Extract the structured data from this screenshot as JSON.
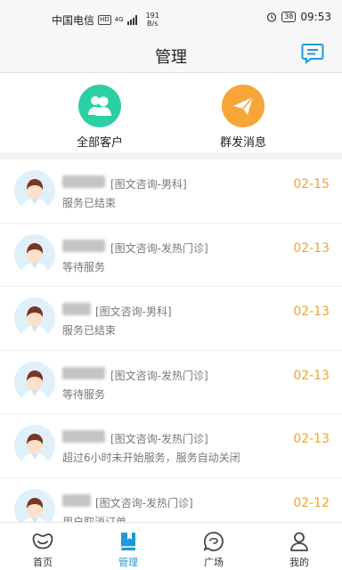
{
  "status_bar": {
    "carrier": "中国电信",
    "hd": "HD",
    "network": "4G",
    "speed_value": "191",
    "speed_unit": "B/s",
    "battery": "38",
    "time": "09:53"
  },
  "header": {
    "title": "管理",
    "message_icon": "chat-bubble-icon"
  },
  "quick_actions": [
    {
      "label": "全部客户",
      "icon": "users-icon",
      "color": "#2ccfa3"
    },
    {
      "label": "群发消息",
      "icon": "paper-plane-icon",
      "color": "#f7a438"
    }
  ],
  "conversations": [
    {
      "tag": "[图文咨询-男科]",
      "status": "服务已结束",
      "date": "02-15"
    },
    {
      "tag": "[图文咨询-发热门诊]",
      "status": "等待服务",
      "date": "02-13"
    },
    {
      "tag": "[图文咨询-男科]",
      "status": "服务已结束",
      "date": "02-13"
    },
    {
      "tag": "[图文咨询-发热门诊]",
      "status": "等待服务",
      "date": "02-13"
    },
    {
      "tag": "[图文咨询-发热门诊]",
      "status": "超过6小时未开始服务，服务自动关闭",
      "date": "02-13"
    },
    {
      "tag": "[图文咨询-发热门诊]",
      "status": "用户取消订单",
      "date": "02-12"
    }
  ],
  "tabbar": [
    {
      "label": "首页",
      "icon": "smile-icon",
      "active": false
    },
    {
      "label": "管理",
      "icon": "book-icon",
      "active": true
    },
    {
      "label": "广场",
      "icon": "chat-circle-icon",
      "active": false
    },
    {
      "label": "我的",
      "icon": "person-icon",
      "active": false
    }
  ],
  "colors": {
    "accent": "#1f9ad6",
    "date": "#f0a526"
  }
}
